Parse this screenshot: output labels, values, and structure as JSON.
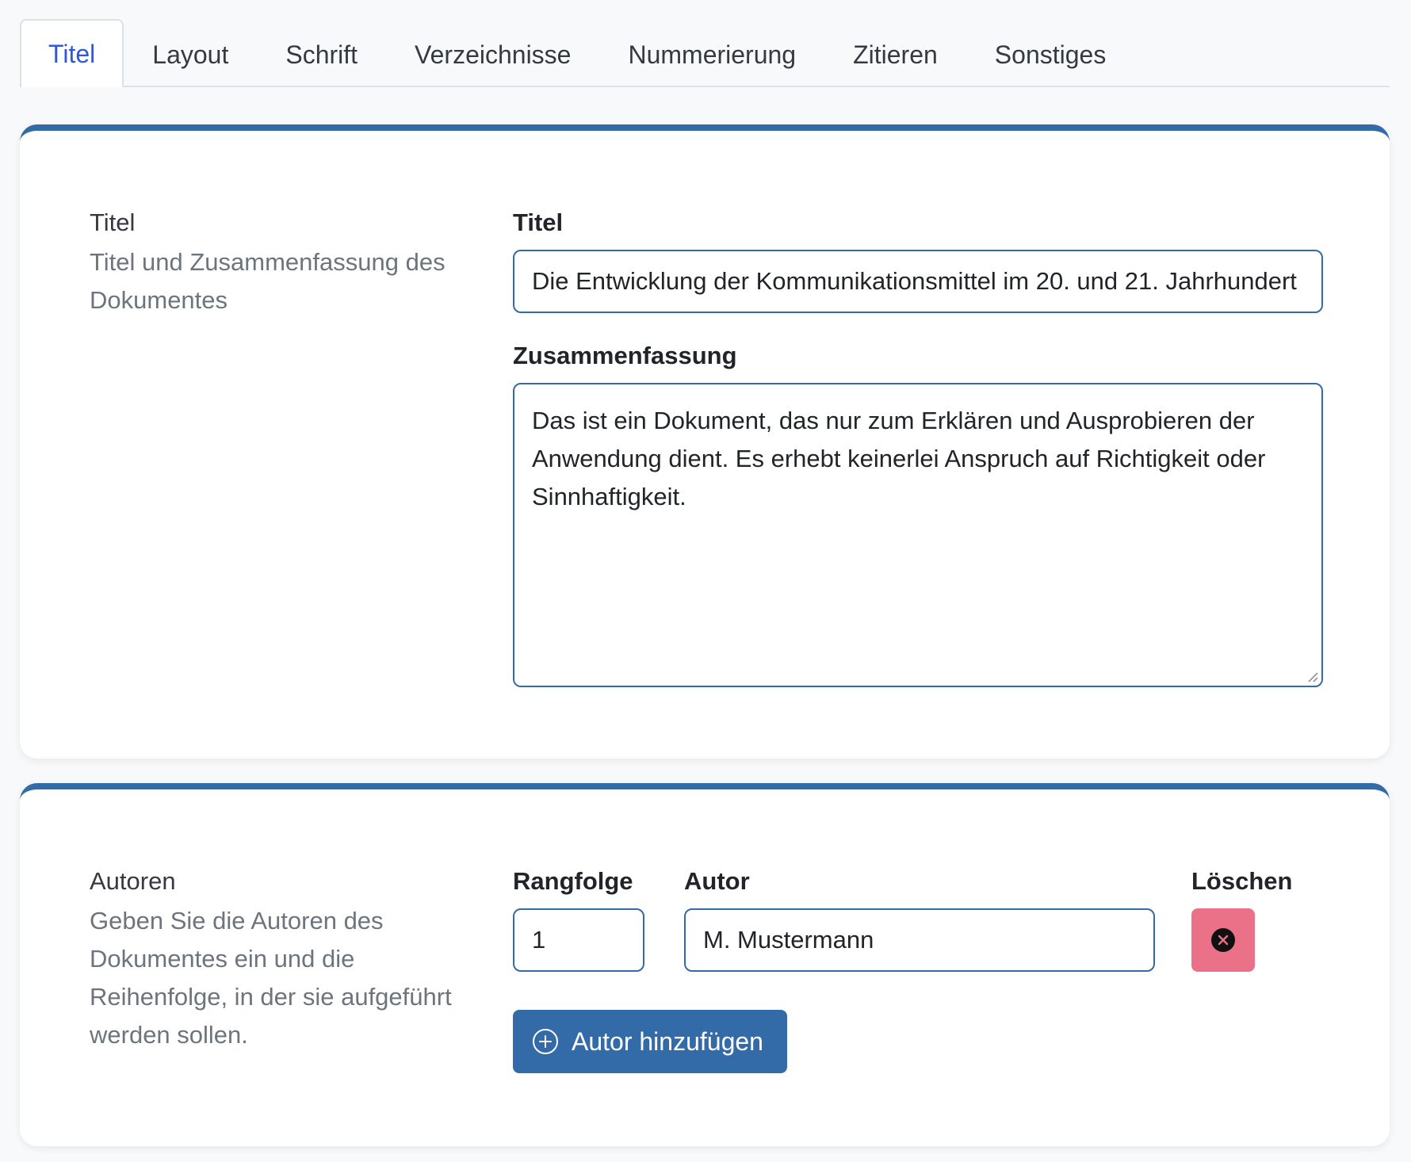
{
  "tabs": [
    {
      "label": "Titel",
      "active": true
    },
    {
      "label": "Layout",
      "active": false
    },
    {
      "label": "Schrift",
      "active": false
    },
    {
      "label": "Verzeichnisse",
      "active": false
    },
    {
      "label": "Nummerierung",
      "active": false
    },
    {
      "label": "Zitieren",
      "active": false
    },
    {
      "label": "Sonstiges",
      "active": false
    }
  ],
  "title_section": {
    "heading": "Titel",
    "description": "Titel und Zusammenfassung des Dokumentes",
    "title_label": "Titel",
    "title_value": "Die Entwicklung der Kommunikationsmittel im 20. und 21. Jahrhundert",
    "summary_label": "Zusammenfassung",
    "summary_value": "Das ist ein Dokument, das nur zum Erklären und Ausprobieren der Anwendung dient. Es erhebt keinerlei Anspruch auf Richtigkeit oder Sinnhaftigkeit."
  },
  "authors_section": {
    "heading": "Autoren",
    "description": "Geben Sie die Autoren des Dokumentes ein und die Reihenfolge, in der sie aufgeführt werden sollen.",
    "col_rank": "Rangfolge",
    "col_author": "Autor",
    "col_delete": "Löschen",
    "rows": [
      {
        "rank": "1",
        "author": "M. Mustermann"
      }
    ],
    "add_button": "Autor hinzufügen"
  },
  "colors": {
    "accent": "#336aa8",
    "active_tab": "#2f56e0",
    "delete": "#ea7187",
    "muted_text": "#6c757d"
  },
  "icons": {
    "delete": "close-circle-icon",
    "add": "plus-circle-icon"
  }
}
